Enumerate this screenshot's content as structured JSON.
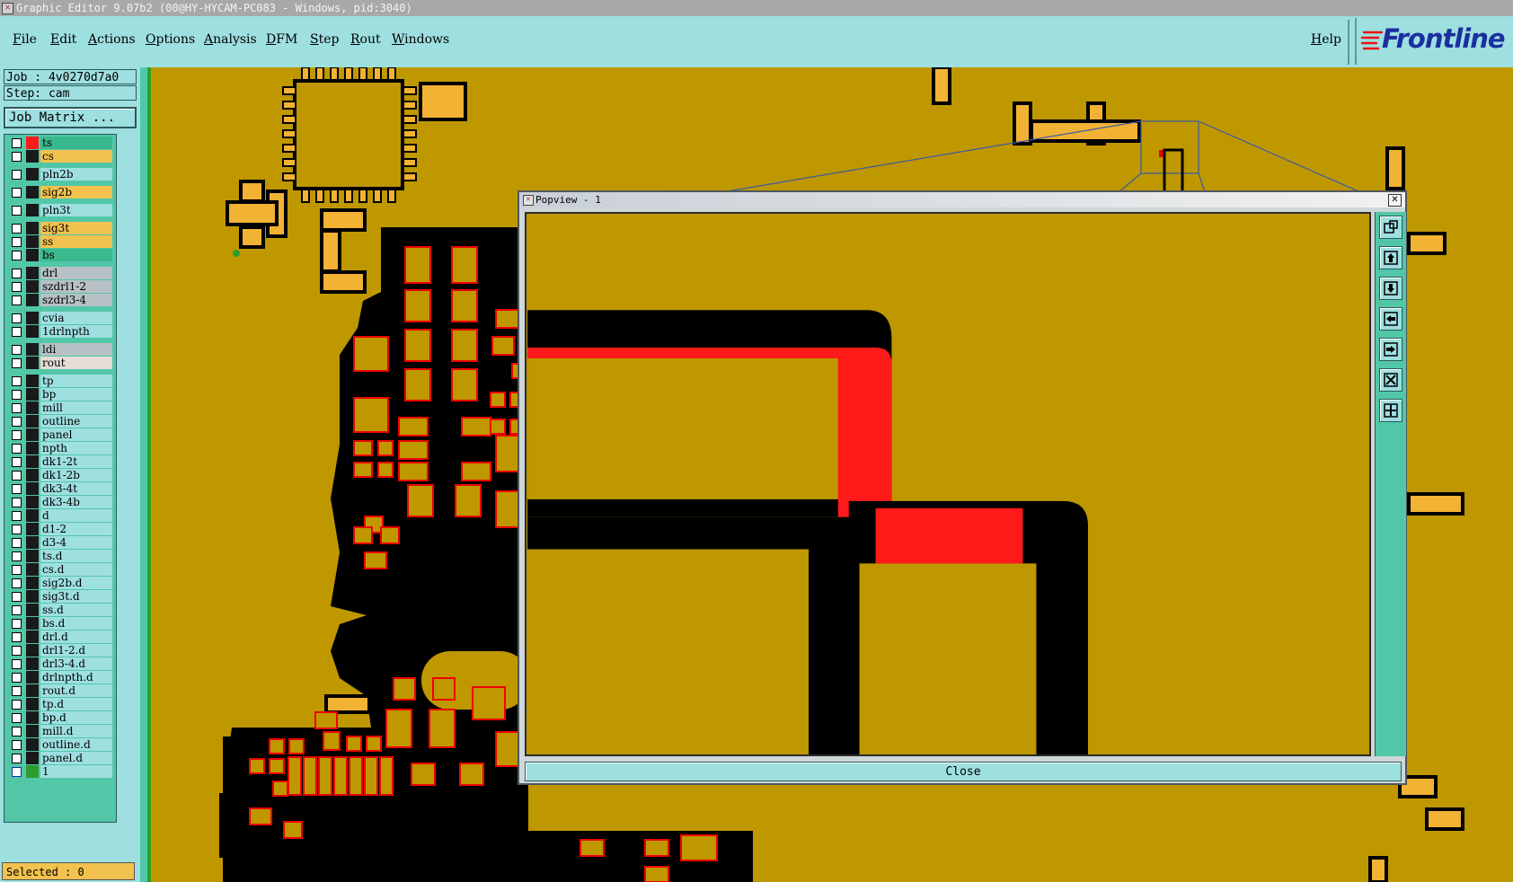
{
  "window": {
    "title": "Graphic Editor 9.07b2 (00@HY-HYCAM-PC083 - Windows, pid:3040)"
  },
  "menu": [
    "File",
    "Edit",
    "Actions",
    "Options",
    "Analysis",
    "DFM",
    "Step",
    "Rout",
    "Windows"
  ],
  "help": "Help",
  "logo": {
    "text": "Frontline",
    "partial": "C"
  },
  "job": {
    "label": "Job : 4v0270d7a0",
    "step": "Step: cam",
    "matrix_button": "Job Matrix ..."
  },
  "layers": [
    {
      "name": "ts",
      "bg": "#3bb98e",
      "swatch": "#ff1a1a"
    },
    {
      "name": "cs",
      "bg": "#f2c24e",
      "swatch": "#1a1a1a"
    },
    {
      "name": "pln2b",
      "bg": "#9edfe0",
      "swatch": "#1a1a1a"
    },
    {
      "name": "sig2b",
      "bg": "#f2c24e",
      "swatch": "#1a1a1a"
    },
    {
      "name": "pln3t",
      "bg": "#9edfe0",
      "swatch": "#1a1a1a"
    },
    {
      "name": "sig3t",
      "bg": "#f2c24e",
      "swatch": "#1a1a1a"
    },
    {
      "name": "ss",
      "bg": "#f2c24e",
      "swatch": "#1a1a1a"
    },
    {
      "name": "bs",
      "bg": "#3bb98e",
      "swatch": "#1a1a1a"
    },
    {
      "name": "drl",
      "bg": "#b7c0c4",
      "swatch": "#1a1a1a"
    },
    {
      "name": "szdrl1-2",
      "bg": "#b7c0c4",
      "swatch": "#1a1a1a"
    },
    {
      "name": "szdrl3-4",
      "bg": "#b7c0c4",
      "swatch": "#1a1a1a"
    },
    {
      "name": "cvia",
      "bg": "#9edfe0",
      "swatch": "#1a1a1a"
    },
    {
      "name": "1drlnpth",
      "bg": "#9edfe0",
      "swatch": "#1a1a1a"
    },
    {
      "name": "ldi",
      "bg": "#b7c0c4",
      "swatch": "#1a1a1a"
    },
    {
      "name": "rout",
      "bg": "#e6dcd6",
      "swatch": "#1a1a1a"
    },
    {
      "name": "tp",
      "bg": "#9edfe0",
      "swatch": "#1a1a1a"
    },
    {
      "name": "bp",
      "bg": "#9edfe0",
      "swatch": "#1a1a1a"
    },
    {
      "name": "mill",
      "bg": "#9edfe0",
      "swatch": "#1a1a1a"
    },
    {
      "name": "outline",
      "bg": "#9edfe0",
      "swatch": "#1a1a1a"
    },
    {
      "name": "panel",
      "bg": "#9edfe0",
      "swatch": "#1a1a1a"
    },
    {
      "name": "npth",
      "bg": "#9edfe0",
      "swatch": "#1a1a1a"
    },
    {
      "name": "dk1-2t",
      "bg": "#9edfe0",
      "swatch": "#1a1a1a"
    },
    {
      "name": "dk1-2b",
      "bg": "#9edfe0",
      "swatch": "#1a1a1a"
    },
    {
      "name": "dk3-4t",
      "bg": "#9edfe0",
      "swatch": "#1a1a1a"
    },
    {
      "name": "dk3-4b",
      "bg": "#9edfe0",
      "swatch": "#1a1a1a"
    },
    {
      "name": "d",
      "bg": "#9edfe0",
      "swatch": "#1a1a1a"
    },
    {
      "name": "d1-2",
      "bg": "#9edfe0",
      "swatch": "#1a1a1a"
    },
    {
      "name": "d3-4",
      "bg": "#9edfe0",
      "swatch": "#1a1a1a"
    },
    {
      "name": "ts.d",
      "bg": "#9edfe0",
      "swatch": "#1a1a1a"
    },
    {
      "name": "cs.d",
      "bg": "#9edfe0",
      "swatch": "#1a1a1a"
    },
    {
      "name": "sig2b.d",
      "bg": "#9edfe0",
      "swatch": "#1a1a1a"
    },
    {
      "name": "sig3t.d",
      "bg": "#9edfe0",
      "swatch": "#1a1a1a"
    },
    {
      "name": "ss.d",
      "bg": "#9edfe0",
      "swatch": "#1a1a1a"
    },
    {
      "name": "bs.d",
      "bg": "#9edfe0",
      "swatch": "#1a1a1a"
    },
    {
      "name": "drl.d",
      "bg": "#9edfe0",
      "swatch": "#1a1a1a"
    },
    {
      "name": "drl1-2.d",
      "bg": "#9edfe0",
      "swatch": "#1a1a1a"
    },
    {
      "name": "drl3-4.d",
      "bg": "#9edfe0",
      "swatch": "#1a1a1a"
    },
    {
      "name": "drlnpth.d",
      "bg": "#9edfe0",
      "swatch": "#1a1a1a"
    },
    {
      "name": "rout.d",
      "bg": "#9edfe0",
      "swatch": "#1a1a1a"
    },
    {
      "name": "tp.d",
      "bg": "#9edfe0",
      "swatch": "#1a1a1a"
    },
    {
      "name": "bp.d",
      "bg": "#9edfe0",
      "swatch": "#1a1a1a"
    },
    {
      "name": "mill.d",
      "bg": "#9edfe0",
      "swatch": "#1a1a1a"
    },
    {
      "name": "outline.d",
      "bg": "#9edfe0",
      "swatch": "#1a1a1a"
    },
    {
      "name": "panel.d",
      "bg": "#9edfe0",
      "swatch": "#1a1a1a"
    },
    {
      "name": "1",
      "bg": "#9edfe0",
      "swatch": "#2e9b2e"
    }
  ],
  "status": {
    "selected": "Selected : 0"
  },
  "popview": {
    "title": "Popview - 1",
    "close_label": "Close",
    "tools": [
      "zoom-fit-icon",
      "pan-up-icon",
      "pan-down-icon",
      "pan-left-icon",
      "pan-right-icon",
      "zoom-out-icon",
      "zoom-in-icon"
    ]
  },
  "colors": {
    "board": "#bf9800",
    "copper_pad": "#f2b233",
    "outline": "#000000",
    "highlight": "#ff0000",
    "panel": "#9edfe0",
    "accent": "#52c7a8"
  }
}
